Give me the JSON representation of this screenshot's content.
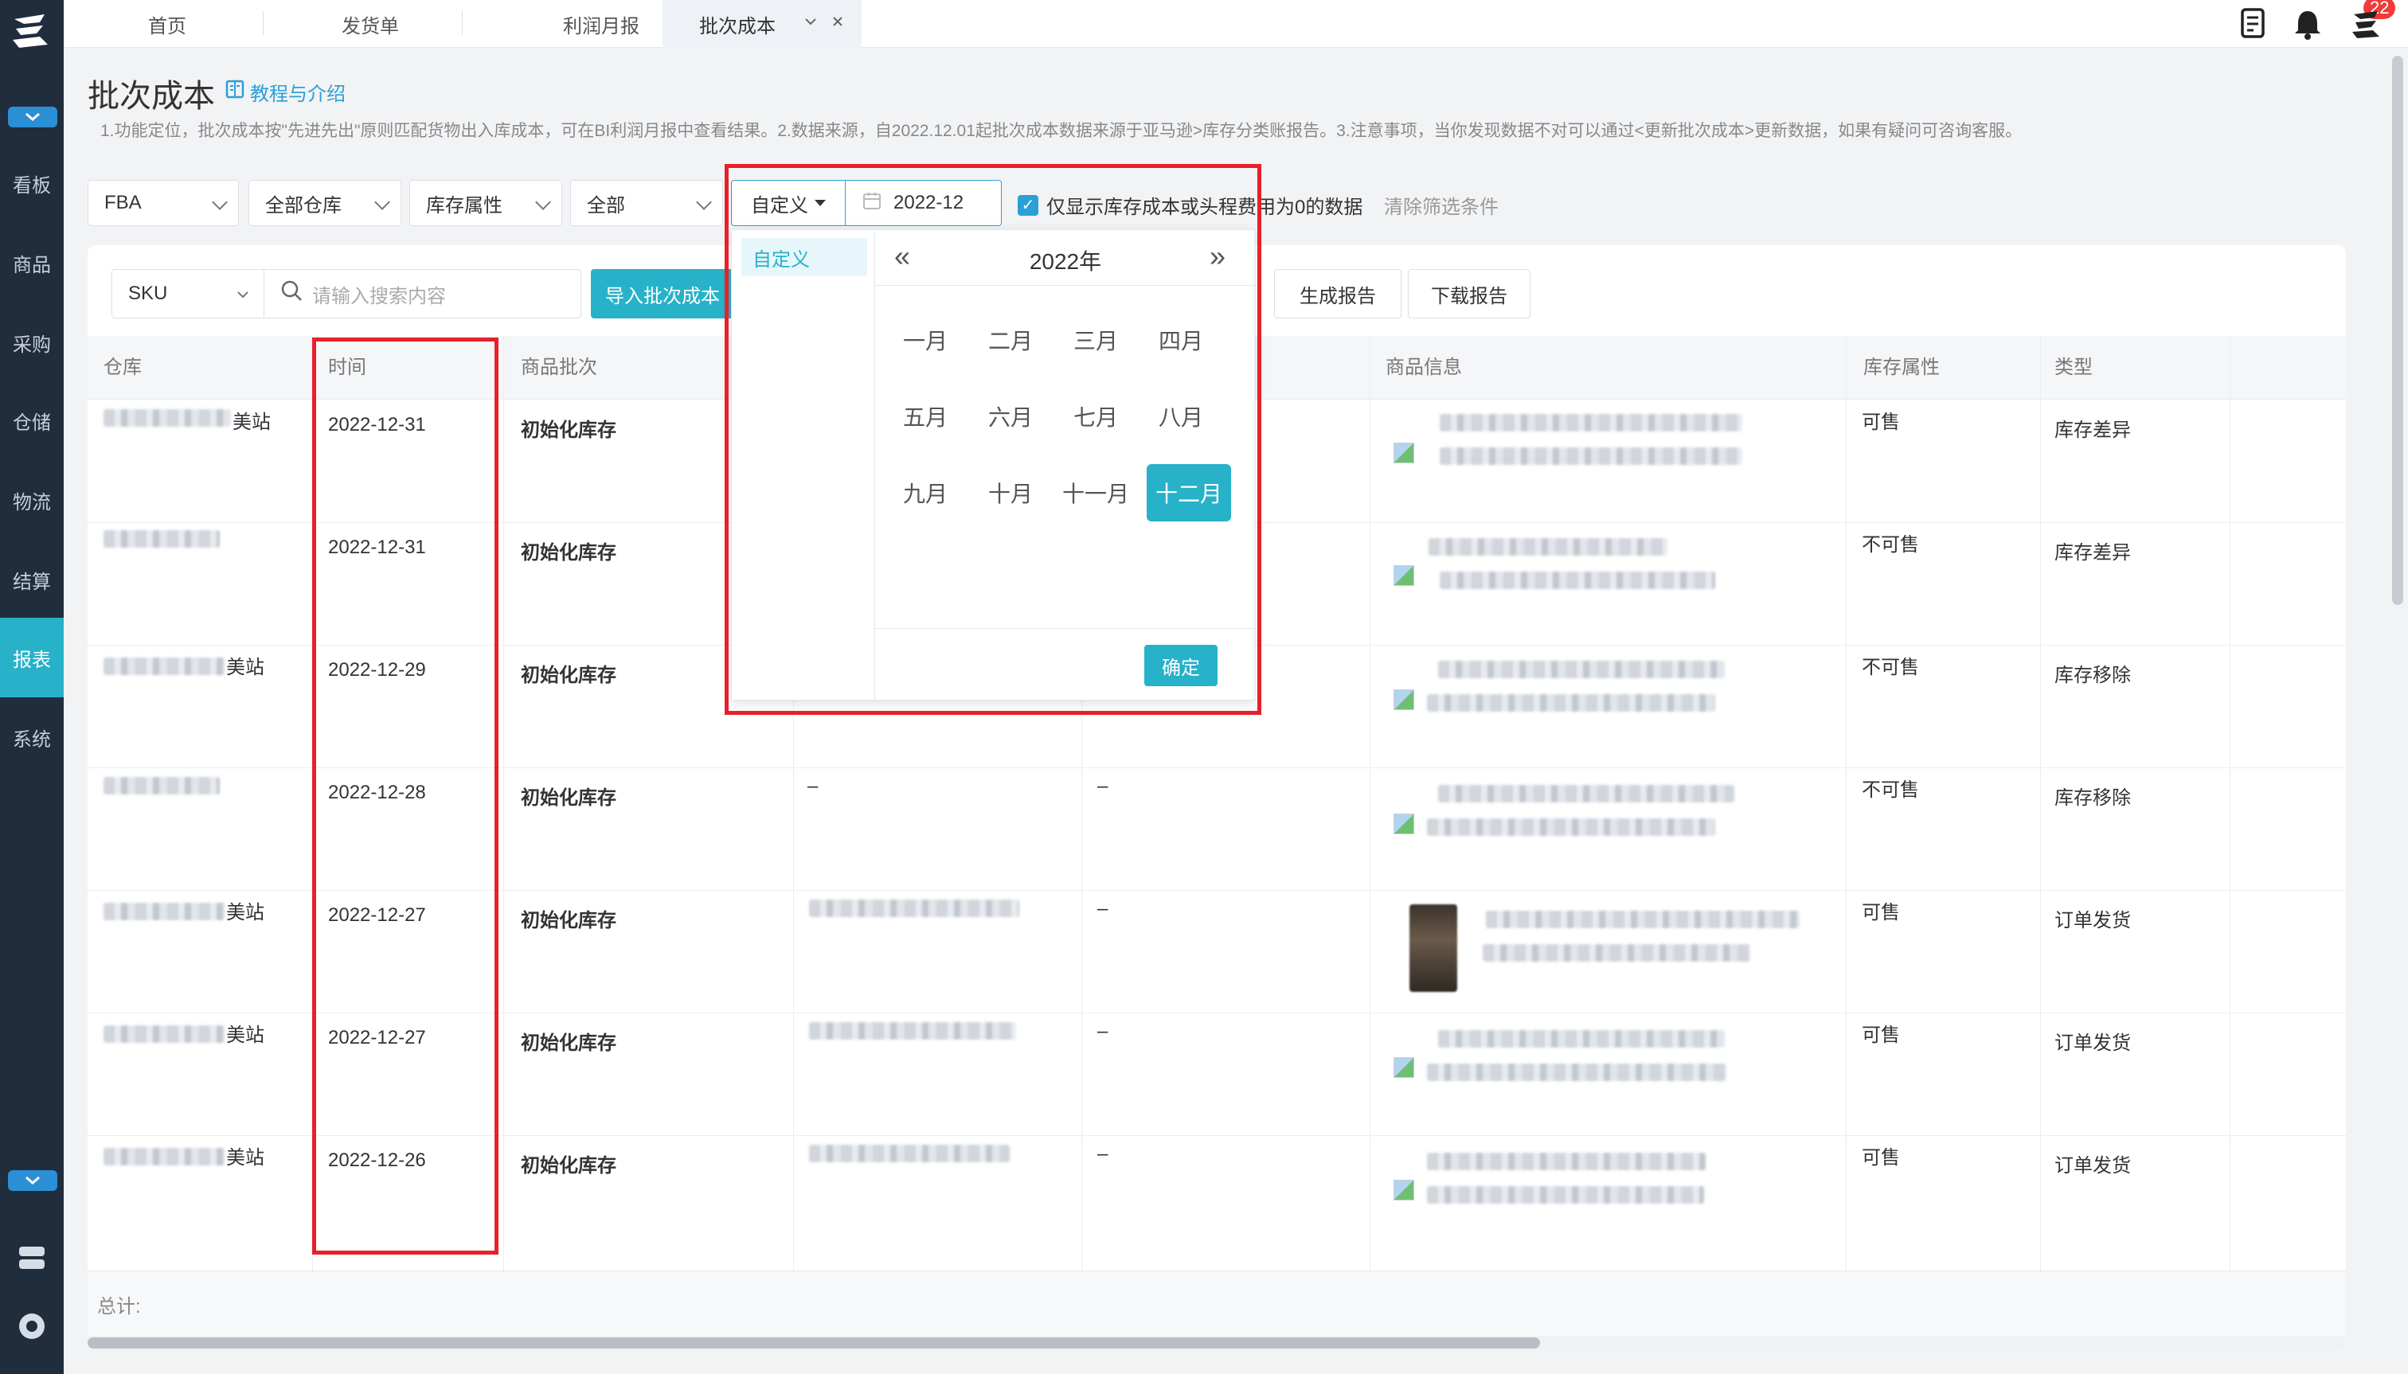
{
  "sidebar": {
    "items": [
      {
        "label": "看板"
      },
      {
        "label": "商品"
      },
      {
        "label": "采购"
      },
      {
        "label": "仓储"
      },
      {
        "label": "物流"
      },
      {
        "label": "结算"
      },
      {
        "label": "报表",
        "active": true
      },
      {
        "label": "系统"
      }
    ]
  },
  "tabs": [
    {
      "label": "首页"
    },
    {
      "label": "发货单"
    },
    {
      "label": "利润月报"
    },
    {
      "label": "批次成本",
      "active": true
    }
  ],
  "notifications": {
    "count": "22"
  },
  "page": {
    "title": "批次成本",
    "guide_link": "教程与介绍",
    "notice": "1.功能定位，批次成本按\"先进先出\"原则匹配货物出入库成本，可在BI利润月报中查看结果。2.数据来源，自2022.12.01起批次成本数据来源于亚马逊>库存分类账报告。3.注意事项，当你发现数据不对可以通过<更新批次成本>更新数据，如果有疑问可咨询客服。"
  },
  "filters": {
    "channel": "FBA",
    "warehouse": "全部仓库",
    "stock_attr": "库存属性",
    "all": "全部",
    "date_mode": "自定义",
    "date_value": "2022-12",
    "only_nonzero_label": "仅显示库存成本或头程费用为0的数据",
    "clear": "清除筛选条件"
  },
  "toolbar": {
    "search_field": "SKU",
    "search_placeholder": "请输入搜索内容",
    "import_button": "导入批次成本",
    "generate_button": "生成报告",
    "download_button": "下载报告"
  },
  "date_picker": {
    "preset": "自定义",
    "year": "2022年",
    "months": [
      "一月",
      "二月",
      "三月",
      "四月",
      "五月",
      "六月",
      "七月",
      "八月",
      "九月",
      "十月",
      "十一月",
      "十二月"
    ],
    "selected_month": "十二月",
    "confirm": "确定"
  },
  "table": {
    "columns": [
      "仓库",
      "时间",
      "商品批次",
      "商品信息",
      "库存属性",
      "类型"
    ],
    "rows": [
      {
        "warehouse_suffix": "美站",
        "time": "2022-12-31",
        "batch": "初始化库存",
        "col4": "",
        "col5": "",
        "attr": "可售",
        "type": "库存差异"
      },
      {
        "warehouse_suffix": "",
        "time": "2022-12-31",
        "batch": "初始化库存",
        "col4": "",
        "col5": "",
        "attr": "不可售",
        "type": "库存差异"
      },
      {
        "warehouse_suffix": "美站",
        "time": "2022-12-29",
        "batch": "初始化库存",
        "col4": "",
        "col5": "",
        "attr": "不可售",
        "type": "库存移除"
      },
      {
        "warehouse_suffix": "",
        "time": "2022-12-28",
        "batch": "初始化库存",
        "col4": "–",
        "col5": "–",
        "attr": "不可售",
        "type": "库存移除"
      },
      {
        "warehouse_suffix": "美站",
        "time": "2022-12-27",
        "batch": "初始化库存",
        "col4": "",
        "col5": "–",
        "attr": "可售",
        "type": "订单发货"
      },
      {
        "warehouse_suffix": "美站",
        "time": "2022-12-27",
        "batch": "初始化库存",
        "col4": "",
        "col5": "–",
        "attr": "可售",
        "type": "订单发货"
      },
      {
        "warehouse_suffix": "美站",
        "time": "2022-12-26",
        "batch": "初始化库存",
        "col4": "",
        "col5": "–",
        "attr": "可售",
        "type": "订单发货"
      }
    ],
    "footer_label": "总计:"
  },
  "colors": {
    "sidebar": "#1f2d3d",
    "accent": "#27b2c9",
    "annotation": "#e8202a"
  }
}
